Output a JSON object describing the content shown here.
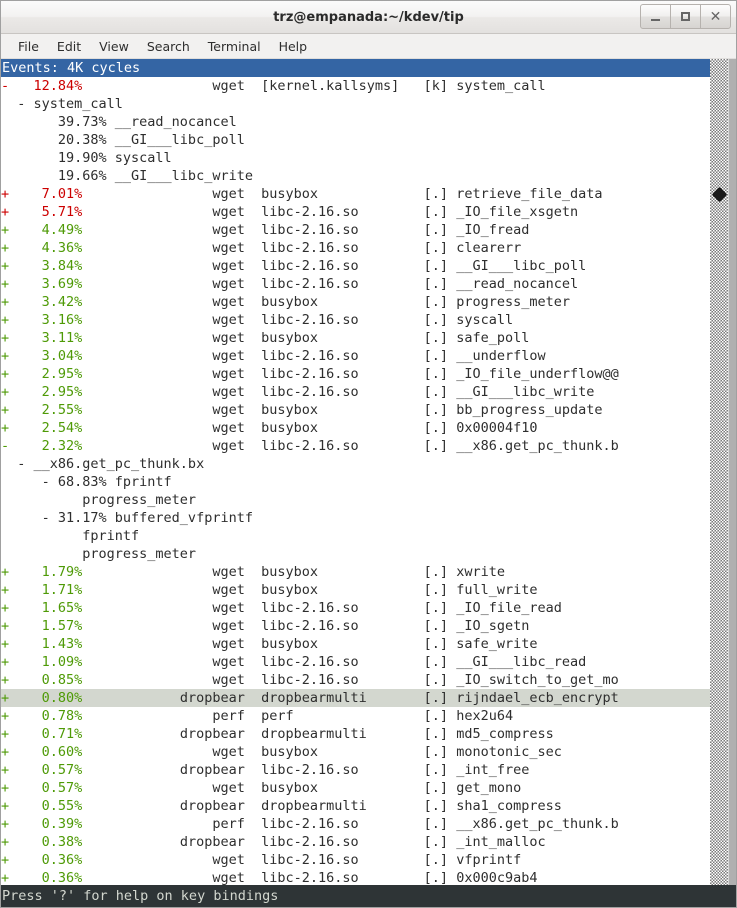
{
  "window": {
    "title": "trz@empanada:~/kdev/tip",
    "buttons": [
      {
        "name": "minimize",
        "glyph": "_"
      },
      {
        "name": "maximize",
        "glyph": "□"
      },
      {
        "name": "close",
        "glyph": "×"
      }
    ]
  },
  "menubar": {
    "items": [
      "File",
      "Edit",
      "View",
      "Search",
      "Terminal",
      "Help"
    ]
  },
  "terminal": {
    "events_header": "Events: 4K cycles",
    "status": "Press '?' for help on key bindings",
    "colors": {
      "header_bg": "#3465a4",
      "header_fg": "#ffffff",
      "pct_high": "#cc0000",
      "pct_low": "#4e9a06",
      "selected_bg": "#d3d7cf",
      "status_bg": "#2e3436",
      "status_fg": "#d3d7cf"
    },
    "rows": [
      {
        "type": "entry",
        "sign": "-",
        "pct": "12.84%",
        "level": "high",
        "command": "wget",
        "dso": "[kernel.kallsyms]",
        "sym_kind": "[k]",
        "symbol": "system_call",
        "selected": false
      },
      {
        "type": "call",
        "text": "  - system_call"
      },
      {
        "type": "call",
        "text": "       39.73% __read_nocancel"
      },
      {
        "type": "call",
        "text": "       20.38% __GI___libc_poll"
      },
      {
        "type": "call",
        "text": "       19.90% syscall"
      },
      {
        "type": "call",
        "text": "       19.66% __GI___libc_write"
      },
      {
        "type": "entry",
        "sign": "+",
        "pct": "7.01%",
        "level": "high",
        "command": "wget",
        "dso": "busybox",
        "sym_kind": "[.]",
        "symbol": "retrieve_file_data",
        "selected": false
      },
      {
        "type": "entry",
        "sign": "+",
        "pct": "5.71%",
        "level": "high",
        "command": "wget",
        "dso": "libc-2.16.so",
        "sym_kind": "[.]",
        "symbol": "_IO_file_xsgetn",
        "selected": false
      },
      {
        "type": "entry",
        "sign": "+",
        "pct": "4.49%",
        "level": "low",
        "command": "wget",
        "dso": "libc-2.16.so",
        "sym_kind": "[.]",
        "symbol": "_IO_fread",
        "selected": false
      },
      {
        "type": "entry",
        "sign": "+",
        "pct": "4.36%",
        "level": "low",
        "command": "wget",
        "dso": "libc-2.16.so",
        "sym_kind": "[.]",
        "symbol": "clearerr",
        "selected": false
      },
      {
        "type": "entry",
        "sign": "+",
        "pct": "3.84%",
        "level": "low",
        "command": "wget",
        "dso": "libc-2.16.so",
        "sym_kind": "[.]",
        "symbol": "__GI___libc_poll",
        "selected": false
      },
      {
        "type": "entry",
        "sign": "+",
        "pct": "3.69%",
        "level": "low",
        "command": "wget",
        "dso": "libc-2.16.so",
        "sym_kind": "[.]",
        "symbol": "__read_nocancel",
        "selected": false
      },
      {
        "type": "entry",
        "sign": "+",
        "pct": "3.42%",
        "level": "low",
        "command": "wget",
        "dso": "busybox",
        "sym_kind": "[.]",
        "symbol": "progress_meter",
        "selected": false
      },
      {
        "type": "entry",
        "sign": "+",
        "pct": "3.16%",
        "level": "low",
        "command": "wget",
        "dso": "libc-2.16.so",
        "sym_kind": "[.]",
        "symbol": "syscall",
        "selected": false
      },
      {
        "type": "entry",
        "sign": "+",
        "pct": "3.11%",
        "level": "low",
        "command": "wget",
        "dso": "busybox",
        "sym_kind": "[.]",
        "symbol": "safe_poll",
        "selected": false
      },
      {
        "type": "entry",
        "sign": "+",
        "pct": "3.04%",
        "level": "low",
        "command": "wget",
        "dso": "libc-2.16.so",
        "sym_kind": "[.]",
        "symbol": "__underflow",
        "selected": false
      },
      {
        "type": "entry",
        "sign": "+",
        "pct": "2.95%",
        "level": "low",
        "command": "wget",
        "dso": "libc-2.16.so",
        "sym_kind": "[.]",
        "symbol": "_IO_file_underflow@@",
        "selected": false
      },
      {
        "type": "entry",
        "sign": "+",
        "pct": "2.95%",
        "level": "low",
        "command": "wget",
        "dso": "libc-2.16.so",
        "sym_kind": "[.]",
        "symbol": "__GI___libc_write",
        "selected": false
      },
      {
        "type": "entry",
        "sign": "+",
        "pct": "2.55%",
        "level": "low",
        "command": "wget",
        "dso": "busybox",
        "sym_kind": "[.]",
        "symbol": "bb_progress_update",
        "selected": false
      },
      {
        "type": "entry",
        "sign": "+",
        "pct": "2.54%",
        "level": "low",
        "command": "wget",
        "dso": "busybox",
        "sym_kind": "[.]",
        "symbol": "0x00004f10",
        "selected": false
      },
      {
        "type": "entry",
        "sign": "-",
        "pct": "2.32%",
        "level": "low",
        "command": "wget",
        "dso": "libc-2.16.so",
        "sym_kind": "[.]",
        "symbol": "__x86.get_pc_thunk.b",
        "selected": false
      },
      {
        "type": "call",
        "text": "  - __x86.get_pc_thunk.bx"
      },
      {
        "type": "call",
        "text": "     - 68.83% fprintf"
      },
      {
        "type": "call",
        "text": "          progress_meter"
      },
      {
        "type": "call",
        "text": "     - 31.17% buffered_vfprintf"
      },
      {
        "type": "call",
        "text": "          fprintf"
      },
      {
        "type": "call",
        "text": "          progress_meter"
      },
      {
        "type": "entry",
        "sign": "+",
        "pct": "1.79%",
        "level": "low",
        "command": "wget",
        "dso": "busybox",
        "sym_kind": "[.]",
        "symbol": "xwrite",
        "selected": false
      },
      {
        "type": "entry",
        "sign": "+",
        "pct": "1.71%",
        "level": "low",
        "command": "wget",
        "dso": "busybox",
        "sym_kind": "[.]",
        "symbol": "full_write",
        "selected": false
      },
      {
        "type": "entry",
        "sign": "+",
        "pct": "1.65%",
        "level": "low",
        "command": "wget",
        "dso": "libc-2.16.so",
        "sym_kind": "[.]",
        "symbol": "_IO_file_read",
        "selected": false
      },
      {
        "type": "entry",
        "sign": "+",
        "pct": "1.57%",
        "level": "low",
        "command": "wget",
        "dso": "libc-2.16.so",
        "sym_kind": "[.]",
        "symbol": "_IO_sgetn",
        "selected": false
      },
      {
        "type": "entry",
        "sign": "+",
        "pct": "1.43%",
        "level": "low",
        "command": "wget",
        "dso": "busybox",
        "sym_kind": "[.]",
        "symbol": "safe_write",
        "selected": false
      },
      {
        "type": "entry",
        "sign": "+",
        "pct": "1.09%",
        "level": "low",
        "command": "wget",
        "dso": "libc-2.16.so",
        "sym_kind": "[.]",
        "symbol": "__GI___libc_read",
        "selected": false
      },
      {
        "type": "entry",
        "sign": "+",
        "pct": "0.85%",
        "level": "low",
        "command": "wget",
        "dso": "libc-2.16.so",
        "sym_kind": "[.]",
        "symbol": "_IO_switch_to_get_mo",
        "selected": false
      },
      {
        "type": "entry",
        "sign": "+",
        "pct": "0.80%",
        "level": "low",
        "command": "dropbear",
        "dso": "dropbearmulti",
        "sym_kind": "[.]",
        "symbol": "rijndael_ecb_encrypt",
        "selected": true
      },
      {
        "type": "entry",
        "sign": "+",
        "pct": "0.78%",
        "level": "low",
        "command": "perf",
        "dso": "perf",
        "sym_kind": "[.]",
        "symbol": "hex2u64",
        "selected": false
      },
      {
        "type": "entry",
        "sign": "+",
        "pct": "0.71%",
        "level": "low",
        "command": "dropbear",
        "dso": "dropbearmulti",
        "sym_kind": "[.]",
        "symbol": "md5_compress",
        "selected": false
      },
      {
        "type": "entry",
        "sign": "+",
        "pct": "0.60%",
        "level": "low",
        "command": "wget",
        "dso": "busybox",
        "sym_kind": "[.]",
        "symbol": "monotonic_sec",
        "selected": false
      },
      {
        "type": "entry",
        "sign": "+",
        "pct": "0.57%",
        "level": "low",
        "command": "dropbear",
        "dso": "libc-2.16.so",
        "sym_kind": "[.]",
        "symbol": "_int_free",
        "selected": false
      },
      {
        "type": "entry",
        "sign": "+",
        "pct": "0.57%",
        "level": "low",
        "command": "wget",
        "dso": "busybox",
        "sym_kind": "[.]",
        "symbol": "get_mono",
        "selected": false
      },
      {
        "type": "entry",
        "sign": "+",
        "pct": "0.55%",
        "level": "low",
        "command": "dropbear",
        "dso": "dropbearmulti",
        "sym_kind": "[.]",
        "symbol": "sha1_compress",
        "selected": false
      },
      {
        "type": "entry",
        "sign": "+",
        "pct": "0.39%",
        "level": "low",
        "command": "perf",
        "dso": "libc-2.16.so",
        "sym_kind": "[.]",
        "symbol": "__x86.get_pc_thunk.b",
        "selected": false
      },
      {
        "type": "entry",
        "sign": "+",
        "pct": "0.38%",
        "level": "low",
        "command": "dropbear",
        "dso": "libc-2.16.so",
        "sym_kind": "[.]",
        "symbol": "_int_malloc",
        "selected": false
      },
      {
        "type": "entry",
        "sign": "+",
        "pct": "0.36%",
        "level": "low",
        "command": "wget",
        "dso": "libc-2.16.so",
        "sym_kind": "[.]",
        "symbol": "vfprintf",
        "selected": false
      },
      {
        "type": "entry",
        "sign": "+",
        "pct": "0.36%",
        "level": "low",
        "command": "wget",
        "dso": "libc-2.16.so",
        "sym_kind": "[.]",
        "symbol": "0x000c9ab4",
        "selected": false
      }
    ],
    "scrollbar": {
      "thumb_row_index": 6
    }
  }
}
